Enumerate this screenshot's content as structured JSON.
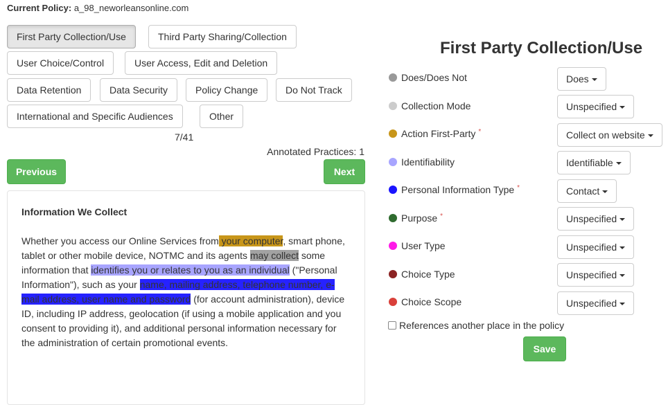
{
  "policy": {
    "label": "Current Policy:",
    "value": "a_98_neworleansonline.com"
  },
  "categories": [
    "First Party Collection/Use",
    "Third Party Sharing/Collection",
    "User Choice/Control",
    "User Access, Edit and Deletion",
    "Data Retention",
    "Data Security",
    "Policy Change",
    "Do Not Track",
    "International and Specific Audiences",
    "Other"
  ],
  "active_category": "First Party Collection/Use",
  "counter": "7/41",
  "annotated": "Annotated Practices: 1",
  "nav": {
    "previous": "Previous",
    "next": "Next"
  },
  "segment": {
    "heading": "Information We Collect",
    "parts": [
      "Whether you access our Online Services from",
      " your computer",
      ", smart phone, tablet or other mobile device, NOTMC and its agents ",
      "may collect",
      " some information that ",
      "identifies you or relates to you as an individual",
      " (\"Personal Information\"), such as your ",
      "name, mailing address, telephone number, e-mail address, user name and password",
      " (for account administration), device ID, including IP address, geolocation (if using a mobile application and you consent to providing it), and additional personal information necessary for the administration of certain promotional events."
    ]
  },
  "form": {
    "title": "First Party Collection/Use",
    "attributes": [
      {
        "label": "Does/Does Not",
        "value": "Does",
        "color": "#999999",
        "required": false
      },
      {
        "label": "Collection Mode",
        "value": "Unspecified",
        "color": "#cccccc",
        "required": false
      },
      {
        "label": "Action First-Party",
        "value": "Collect on website",
        "color": "#c8961a",
        "required": true
      },
      {
        "label": "Identifiability",
        "value": "Identifiable",
        "color": "#a8a5ff",
        "required": false
      },
      {
        "label": "Personal Information Type",
        "value": "Contact",
        "color": "#1a14ff",
        "required": true
      },
      {
        "label": "Purpose",
        "value": "Unspecified",
        "color": "#2f6b2f",
        "required": true
      },
      {
        "label": "User Type",
        "value": "Unspecified",
        "color": "#ff1ae8",
        "required": false
      },
      {
        "label": "Choice Type",
        "value": "Unspecified",
        "color": "#8b2323",
        "required": false
      },
      {
        "label": "Choice Scope",
        "value": "Unspecified",
        "color": "#d9403a",
        "required": false
      }
    ],
    "required_marker": "*",
    "reference_checkbox": "References another place in the policy",
    "save": "Save"
  }
}
